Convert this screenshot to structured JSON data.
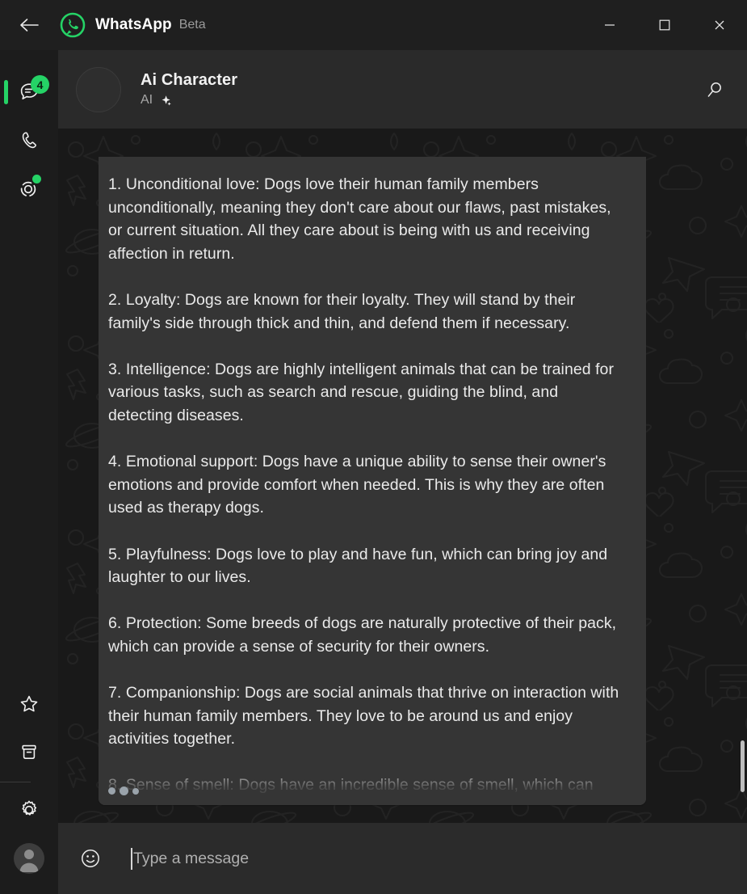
{
  "window": {
    "title": "WhatsApp",
    "badge_label": "Beta",
    "back_icon": "back-arrow-icon",
    "logo_icon": "whatsapp-logo-icon",
    "minimize_label": "Minimize",
    "maximize_label": "Maximize",
    "close_label": "Close",
    "accent_color": "#25d366",
    "titlebar_color": "#1f1f1f"
  },
  "sidebar": {
    "items": [
      {
        "name": "chats",
        "icon": "chats-icon",
        "badge": "4",
        "active": true
      },
      {
        "name": "calls",
        "icon": "phone-icon",
        "badge": "",
        "active": false
      },
      {
        "name": "status",
        "icon": "status-ring-icon",
        "badge": "",
        "active": false
      }
    ],
    "bottom_items": [
      {
        "name": "starred-messages",
        "icon": "star-icon"
      },
      {
        "name": "archived",
        "icon": "archive-box-icon"
      },
      {
        "name": "settings",
        "icon": "gear-icon"
      },
      {
        "name": "profile",
        "icon": "profile-avatar-icon"
      }
    ]
  },
  "chat_header": {
    "contact_name": "Ai Character",
    "subtitle": "AI",
    "subtitle_icon": "sparkle-icon",
    "avatar_icon": "contact-avatar",
    "search_icon": "search-icon"
  },
  "conversation": {
    "message": "1. Unconditional love: Dogs love their human family members unconditionally, meaning they don't care about our flaws, past mistakes, or current situation. All they care about is being with us and receiving affection in return.\n\n2. Loyalty: Dogs are known for their loyalty. They will stand by their family's side through thick and thin, and defend them if necessary.\n\n3. Intelligence: Dogs are highly intelligent animals that can be trained for various tasks, such as search and rescue, guiding the blind, and detecting diseases.\n\n4. Emotional support: Dogs have a unique ability to sense their owner's emotions and provide comfort when needed. This is why they are often used as therapy dogs.\n\n5. Playfulness: Dogs love to play and have fun, which can bring joy and laughter to our lives.\n\n6. Protection: Some breeds of dogs are naturally protective of their pack, which can provide a sense of security for their owners.\n\n7. Companionship: Dogs are social animals that thrive on interaction with their human family members. They love to be around us and enjoy activities together.\n\n8. Sense of smell: Dogs have an incredible sense of smell, which can",
    "typing_indicator": "typing-dots",
    "bubble_color": "#353535"
  },
  "composer": {
    "emoji_icon": "emoji-smiley-icon",
    "input_value": "",
    "placeholder": "Type a message"
  }
}
